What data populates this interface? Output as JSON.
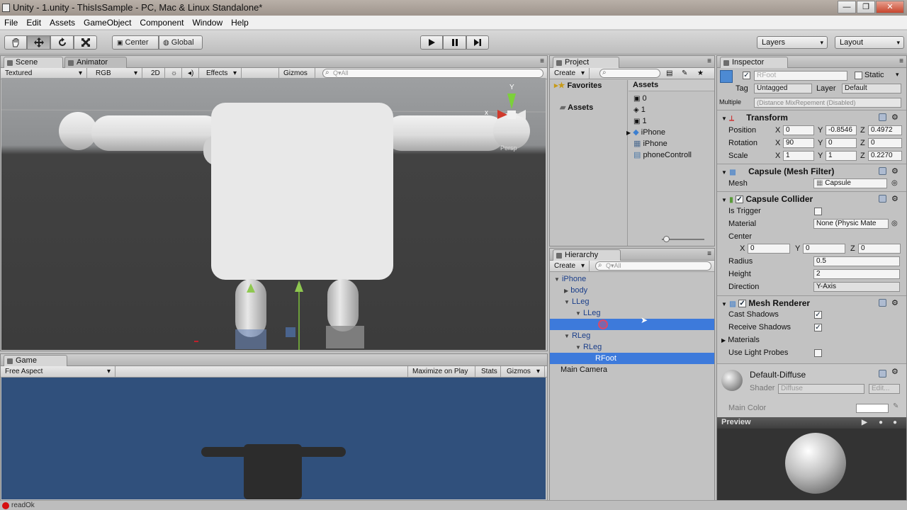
{
  "window": {
    "title": "Unity - 1.unity - ThisIsSample - PC, Mac & Linux Standalone*",
    "minimize": "—",
    "maximize": "❐",
    "close": "✕"
  },
  "menu": [
    "File",
    "Edit",
    "Assets",
    "GameObject",
    "Component",
    "Window",
    "Help"
  ],
  "toolbar": {
    "pivot": "Center",
    "space": "Global",
    "layers": "Layers",
    "layout": "Layout"
  },
  "scene": {
    "tab": "Scene",
    "animator_tab": "Animator",
    "shading": "Textured",
    "render": "RGB",
    "mode2d": "2D",
    "effects": "Effects",
    "gizmos": "Gizmos",
    "search_placeholder": "Q▾All",
    "gizmo_y": "Y",
    "gizmo_x": "x",
    "persp": "Persp"
  },
  "game": {
    "tab": "Game",
    "aspect": "Free Aspect",
    "maximize": "Maximize on Play",
    "stats": "Stats",
    "gizmos": "Gizmos"
  },
  "project": {
    "tab": "Project",
    "create": "Create",
    "favorites": "Favorites",
    "assets_tree": "Assets",
    "assets_header": "Assets",
    "items": [
      {
        "label": "0",
        "icon": "scene-icon"
      },
      {
        "label": "1",
        "icon": "anim-controller-icon"
      },
      {
        "label": "1",
        "icon": "scene-icon"
      },
      {
        "label": "iPhone",
        "icon": "prefab-icon"
      },
      {
        "label": "iPhone",
        "icon": "model-icon"
      },
      {
        "label": "phoneControll",
        "icon": "script-icon"
      }
    ]
  },
  "hierarchy": {
    "tab": "Hierarchy",
    "create": "Create",
    "search_placeholder": "Q▾All",
    "rows": [
      {
        "label": "iPhone",
        "indent": 0,
        "arrow": "▼",
        "selected": false
      },
      {
        "label": "body",
        "indent": 1,
        "arrow": "▶",
        "selected": false
      },
      {
        "label": "LLeg",
        "indent": 1,
        "arrow": "▼",
        "selected": false
      },
      {
        "label": "LLeg",
        "indent": 2,
        "arrow": "▼",
        "selected": false
      },
      {
        "label": "",
        "indent": 3,
        "arrow": "",
        "selected": true
      },
      {
        "label": "RLeg",
        "indent": 1,
        "arrow": "▼",
        "selected": false
      },
      {
        "label": "RLeg",
        "indent": 2,
        "arrow": "▼",
        "selected": false
      },
      {
        "label": "RFoot",
        "indent": 3,
        "arrow": "",
        "selected": true
      },
      {
        "label": "Main Camera",
        "indent": 0,
        "arrow": "",
        "selected": false
      }
    ]
  },
  "inspector": {
    "tab": "Inspector",
    "name": "RFoot",
    "static": "Static",
    "tag_label": "Tag",
    "tag": "Untagged",
    "layer_label": "Layer",
    "layer": "Default",
    "multiple_label": "Multiple",
    "multiple": "(Distance MixRepement (Disabled)",
    "transform": {
      "title": "Transform",
      "rows": [
        {
          "label": "Position",
          "x": "0",
          "y": "-0.8546",
          "z": "0.4972"
        },
        {
          "label": "Rotation",
          "x": "90",
          "y": "0",
          "z": "0"
        },
        {
          "label": "Scale",
          "x": "1",
          "y": "1",
          "z": "0.2270"
        }
      ]
    },
    "mesh_filter": {
      "title": "Capsule (Mesh Filter)",
      "mesh_label": "Mesh",
      "mesh": "Capsule"
    },
    "collider": {
      "title": "Capsule Collider",
      "is_trigger": "Is Trigger",
      "material_label": "Material",
      "material": "None (Physic Mate",
      "center": "Center",
      "cx": "0",
      "cy": "0",
      "cz": "0",
      "radius_label": "Radius",
      "radius": "0.5",
      "height_label": "Height",
      "height": "2",
      "direction_label": "Direction",
      "direction": "Y-Axis"
    },
    "renderer": {
      "title": "Mesh Renderer",
      "cast": "Cast Shadows",
      "receive": "Receive Shadows",
      "materials": "Materials",
      "light_probes": "Use Light Probes"
    },
    "material": {
      "name": "Default-Diffuse",
      "shader_label": "Shader",
      "shader": "Diffuse",
      "edit": "Edit...",
      "main_color": "Main Color"
    },
    "preview": "Preview"
  },
  "status": "readOk"
}
